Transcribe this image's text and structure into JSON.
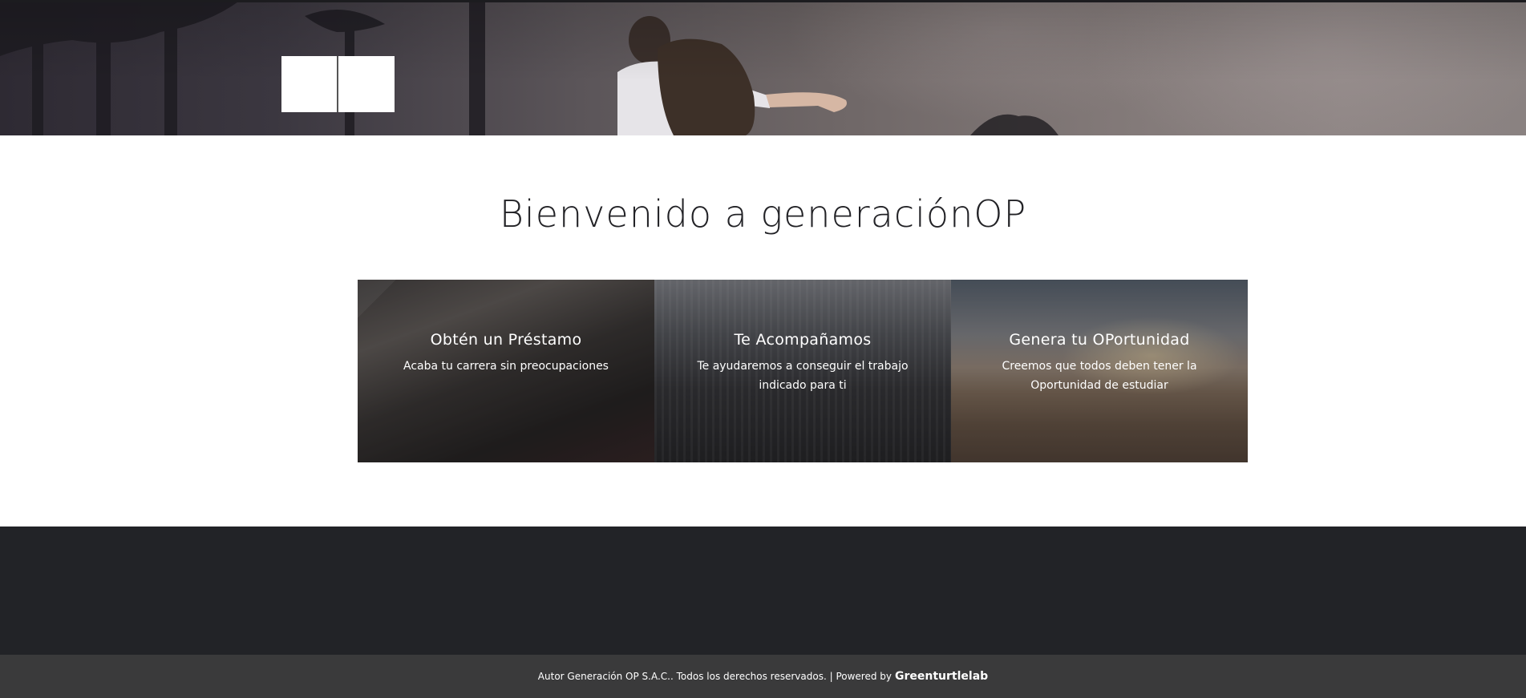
{
  "hero": {
    "logo_alt": "generaciónOP logo"
  },
  "welcome": {
    "title": "Bienvenido a generaciónOP"
  },
  "cards": [
    {
      "title": "Obtén un Préstamo",
      "text": "Acaba tu carrera sin preocupaciones"
    },
    {
      "title": "Te Acompañamos",
      "text": "Te ayudaremos a conseguir el trabajo indicado para ti"
    },
    {
      "title": "Genera tu OPortunidad",
      "text": "Creemos que todos deben tener la Oportunidad de estudiar"
    }
  ],
  "footer": {
    "copyright": "Autor Generación OP S.A.C.. Todos los derechos reservados. | Powered by",
    "brand": "Greenturtlelab"
  },
  "colors": {
    "footer_dark": "#222327",
    "footer_bar": "#3a3a3b",
    "title_text": "#222226"
  }
}
